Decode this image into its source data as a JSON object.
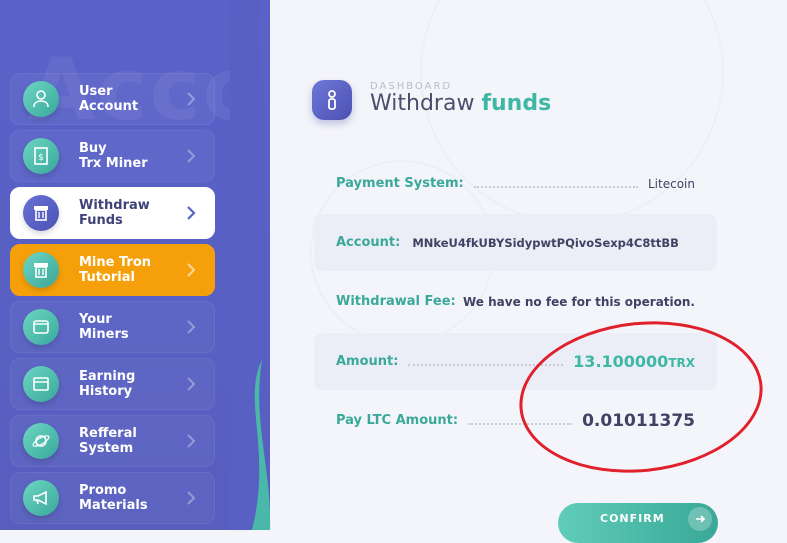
{
  "sidebar": {
    "watermark": "Account",
    "items": [
      {
        "line1": "User",
        "line2": "Account",
        "icon": "user-icon",
        "state": "normal"
      },
      {
        "line1": "Buy",
        "line2": "Trx Miner",
        "icon": "receipt-dollar-icon",
        "state": "normal"
      },
      {
        "line1": "Withdraw",
        "line2": "Funds",
        "icon": "atm-icon",
        "state": "active"
      },
      {
        "line1": "Mine Tron",
        "line2": "Tutorial",
        "icon": "atm-icon",
        "state": "highlight"
      },
      {
        "line1": "Your",
        "line2": "Miners",
        "icon": "folder-icon",
        "state": "normal"
      },
      {
        "line1": "Earning",
        "line2": "History",
        "icon": "window-icon",
        "state": "normal"
      },
      {
        "line1": "Refferal",
        "line2": "System",
        "icon": "planet-icon",
        "state": "normal"
      },
      {
        "line1": "Promo",
        "line2": "Materials",
        "icon": "megaphone-icon",
        "state": "normal"
      }
    ]
  },
  "header": {
    "subtitle": "DASHBOARD",
    "title_plain": "Withdraw",
    "title_accent": "funds",
    "icon": "info-icon"
  },
  "form": {
    "payment_system_label": "Payment System:",
    "payment_system_value": "Litecoin",
    "account_label": "Account:",
    "account_value": "MNkeU4fkUBYSidypwtPQivoSexp4C8ttBB",
    "fee_label": "Withdrawal Fee:",
    "fee_value": "We have no fee for this operation.",
    "amount_label": "Amount:",
    "amount_value": "13.100000",
    "amount_unit": "TRX",
    "pay_label": "Pay LTC Amount:",
    "pay_value": "0.01011375"
  },
  "confirm": {
    "label": "CONFIRM",
    "icon": "arrow-right-icon"
  },
  "colors": {
    "sidebar": "#5a62c9",
    "accent": "#3fb7a5",
    "highlight": "#f5a00a",
    "annotation": "#e0202b"
  }
}
